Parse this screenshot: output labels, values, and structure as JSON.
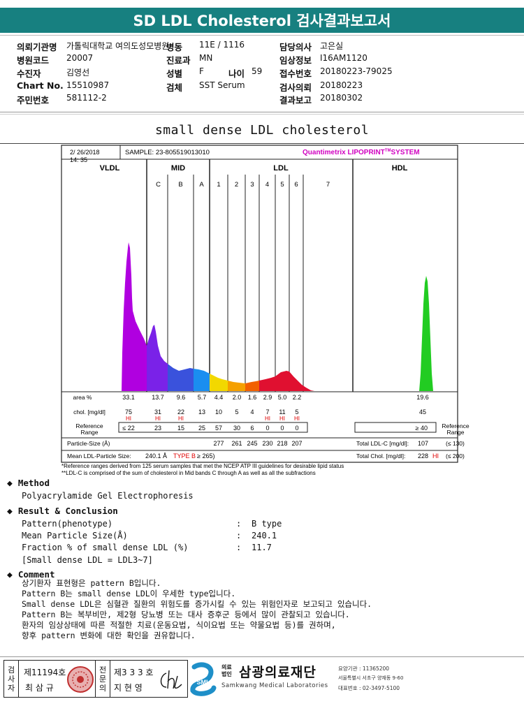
{
  "report": {
    "title": "SD LDL Cholesterol 검사결과보고서",
    "subtitle": "small dense LDL cholesterol"
  },
  "header": {
    "rows": [
      {
        "l1": "의뢰기관명",
        "v1": "가톨릭대학교 여의도성모병원",
        "l2": "병동",
        "v2": "11E / 1116",
        "l3": "담당의사",
        "v3": "고은실"
      },
      {
        "l1": "병원코드",
        "v1": "20007",
        "l2": "진료과",
        "v2": "MN",
        "l3": "임상정보",
        "v3": "I16AM1120"
      },
      {
        "l1": "수진자",
        "v1": "김영선",
        "l2": "성별",
        "v2": "F",
        "l2b": "나이",
        "v2b": "59",
        "l3": "접수번호",
        "v3": "20180223-79025"
      },
      {
        "l1": "Chart No.",
        "v1": "15510987",
        "l2": "검체",
        "v2": "SST Serum",
        "l3": "검사의뢰",
        "v3": "20180223"
      },
      {
        "l1": "주민번호",
        "v1": "581112-2",
        "l2": "",
        "v2": "",
        "l3": "결과보고",
        "v3": "20180302"
      }
    ]
  },
  "chart_data": {
    "type": "area",
    "date": "2/ 26/2018",
    "time": "14: 35",
    "sample": "SAMPLE:  23-805519013010",
    "system": "Quantimetrix LIPOPRINT",
    "system_tm": "TM",
    "system_suffix": "SYSTEM",
    "bands": [
      "VLDL",
      "MID",
      "LDL",
      "HDL"
    ],
    "sub_bands": [
      "C",
      "B",
      "A",
      "1",
      "2",
      "3",
      "4",
      "5",
      "6",
      "7"
    ],
    "area_label": "area %",
    "area": [
      "33.1",
      "13.7",
      "9.6",
      "5.7",
      "4.4",
      "2.0",
      "1.6",
      "2.9",
      "5.0",
      "2.2",
      "19.6"
    ],
    "chol_label": "chol. [mg/dl]",
    "chol": [
      "75",
      "31",
      "22",
      "13",
      "10",
      "5",
      "4",
      "7",
      "11",
      "5",
      "45"
    ],
    "hi_flags": [
      true,
      true,
      true,
      false,
      false,
      false,
      false,
      true,
      true,
      true,
      false
    ],
    "hi_text": "HI",
    "ref_label_1": "Reference",
    "ref_label_2": "Range",
    "ref": [
      "≤ 22",
      "23",
      "15",
      "25",
      "57",
      "30",
      "6",
      "0",
      "0",
      "0"
    ],
    "ref_hdl": "≥ 40",
    "particle_label": "Particle-Size (Å)",
    "particle": [
      "277",
      "261",
      "245",
      "230",
      "218",
      "207"
    ],
    "mean_label": "Mean LDL-Particle Size:",
    "mean_value": "240.1 Å",
    "mean_type": "TYPE B",
    "mean_ref": "≥ 265)",
    "total_ldl_label": "Total LDL-C [mg/dl]:",
    "total_ldl": "107",
    "total_ldl_ref": "(≤ 130)",
    "total_chol_label": "Total Chol. [mg/dl]:",
    "total_chol": "228",
    "total_chol_flag": "HI",
    "total_chol_ref": "(≤ 200)",
    "note1": "*Reference ranges derived from 125 serum samples that met the NCEP ATP III guidelines for desirable lipid status",
    "note2": "**LDL-C is comprised of the sum of cholesterol in Mid bands C through A as well as all the subfractions",
    "colors": {
      "vldl": "#b000e0",
      "midc": "#7a22e8",
      "midb": "#3a52dc",
      "mida": "#1a8ef0",
      "ldl1": "#f2d800",
      "ldl2": "#f5a000",
      "ldl3": "#f26000",
      "ldl47": "#e01030",
      "hdl": "#22cc22",
      "title": "#d000c0",
      "hi": "#e00000"
    }
  },
  "method": {
    "heading": "Method",
    "text": "Polyacrylamide Gel Electrophoresis"
  },
  "result": {
    "heading": "Result & Conclusion",
    "items": [
      {
        "label": "Pattern(phenotype)",
        "value": "B type"
      },
      {
        "label": "Mean Particle Size(Å)",
        "value": "240.1"
      },
      {
        "label": "Fraction % of small dense LDL (%)",
        "value": "11.7"
      }
    ],
    "note": "[Small dense LDL = LDL3~7]",
    "colon": ":"
  },
  "comment": {
    "heading": "Comment",
    "lines": [
      "상기환자 표현형은 pattern B입니다.",
      "Pattern B는 small dense LDL이 우세한 type입니다.",
      "Small dense LDL은 심혈관 질환의 위험도를 증가시킬 수 있는 위험인자로 보고되고 있습니다.",
      "Pattern B는 복부비만, 제2형 당뇨병 또는 대사 증후군 등에서 많이 관찰되고 있습니다.",
      "환자의 임상상태에 따른 적절한 치료(운동요법, 식이요법 또는 약물요법 등)를 권하며,",
      "향후 pattern 변화에 대한 확인을 권유합니다."
    ]
  },
  "footer": {
    "exam_label": [
      "검",
      "사",
      "자"
    ],
    "exam_no": "제11194호",
    "exam_name": "최 삼 규",
    "spec_label": [
      "전",
      "문",
      "의"
    ],
    "spec_no": "제3 3 3 호",
    "spec_name": "지 현 영",
    "org_prefix_1": "의료",
    "org_prefix_2": "법인",
    "org_name": "삼광의료재단",
    "org_en": "Samkwang Medical Laboratories",
    "logo_text": "SML",
    "info1": "요양기관 : 11365200",
    "info2": "서울특별시 서초구 양재동 9-60",
    "info3": "대표번호 : 02-3497-5100"
  }
}
